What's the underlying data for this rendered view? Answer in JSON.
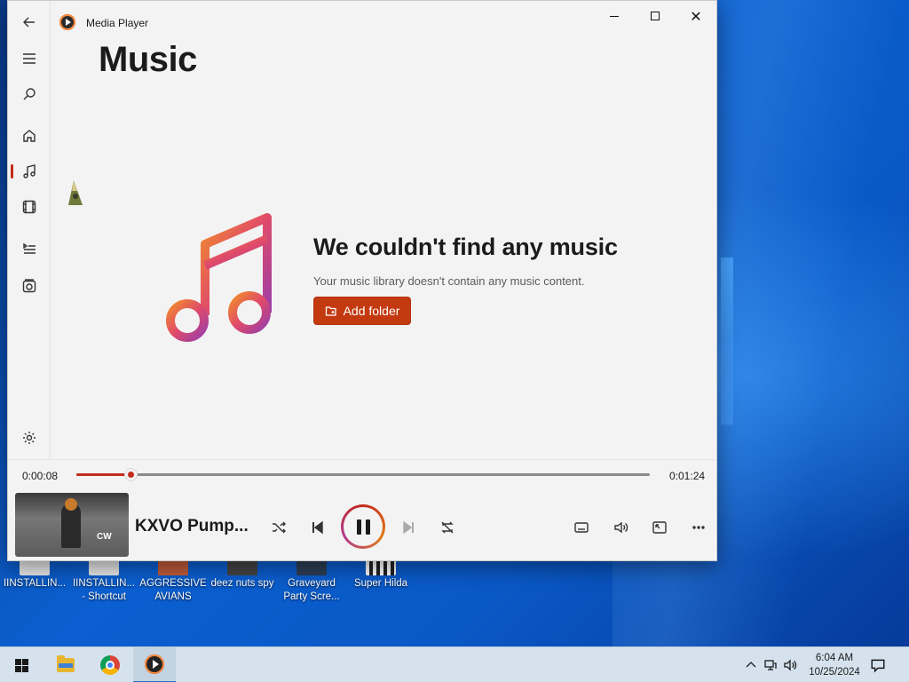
{
  "window": {
    "app_title": "Media Player",
    "page_title": "Music"
  },
  "sidebar": {
    "items": [
      {
        "id": "back",
        "icon": "back-arrow-icon"
      },
      {
        "id": "menu",
        "icon": "hamburger-menu-icon"
      },
      {
        "id": "search",
        "icon": "search-icon"
      },
      {
        "id": "home",
        "icon": "home-icon"
      },
      {
        "id": "music",
        "icon": "music-note-icon",
        "active": true
      },
      {
        "id": "videos",
        "icon": "film-icon"
      },
      {
        "id": "play-queue",
        "icon": "play-queue-icon"
      },
      {
        "id": "playlists",
        "icon": "playlists-icon"
      },
      {
        "id": "settings",
        "icon": "gear-icon"
      }
    ]
  },
  "empty_state": {
    "heading": "We couldn't find any music",
    "subtext": "Your music library doesn't contain any music content.",
    "button_label": "Add folder"
  },
  "player": {
    "current_time": "0:00:08",
    "duration": "0:01:24",
    "progress_fraction": 0.095,
    "song_title": "KXVO Pump...",
    "album_art_text": "CW",
    "accent_color": "#c42b1c"
  },
  "desktop_icons": [
    {
      "label": "IINSTALLIN..."
    },
    {
      "label": "IINSTALLIN... - Shortcut"
    },
    {
      "label": "AGGRESSIVE AVIANS"
    },
    {
      "label": "deez nuts spy"
    },
    {
      "label": "Graveyard Party Scre..."
    },
    {
      "label": "Super Hilda"
    }
  ],
  "taskbar": {
    "time": "6:04 AM",
    "date": "10/25/2024"
  }
}
